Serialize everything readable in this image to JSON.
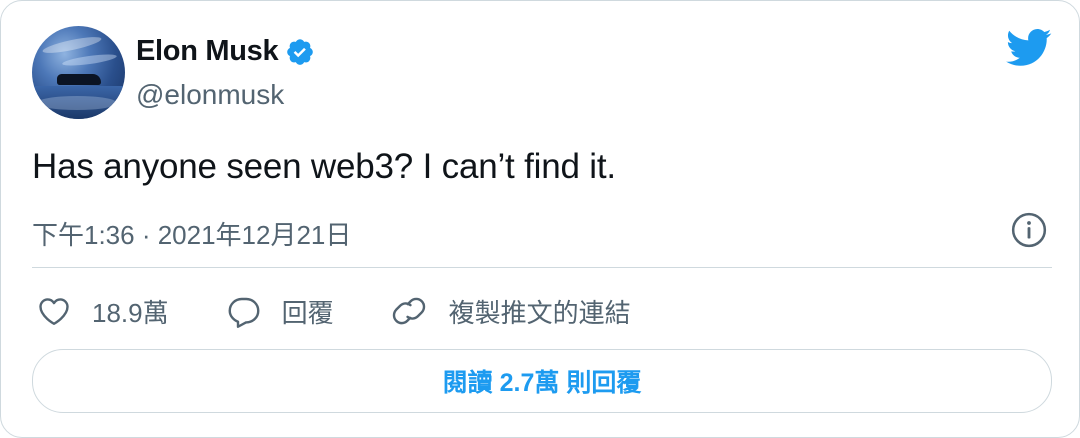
{
  "user": {
    "display_name": "Elon Musk",
    "handle": "@elonmusk",
    "verified": true
  },
  "tweet": {
    "text": "Has anyone seen web3? I can’t find it.",
    "timestamp": "下午1:36 · 2021年12月21日"
  },
  "actions": {
    "like_count": "18.9萬",
    "reply_label": "回覆",
    "copy_link_label": "複製推文的連結"
  },
  "read_replies_label": "閱讀 2.7萬 則回覆",
  "icons": {
    "brand": "twitter-bird-icon",
    "verified": "verified-badge-icon",
    "info": "info-icon",
    "like": "heart-icon",
    "reply": "reply-bubble-icon",
    "copy": "link-icon"
  },
  "colors": {
    "brand_blue": "#1d9bf0",
    "text_primary": "#0f1419",
    "text_secondary": "#536471",
    "border": "#cfd9de"
  }
}
